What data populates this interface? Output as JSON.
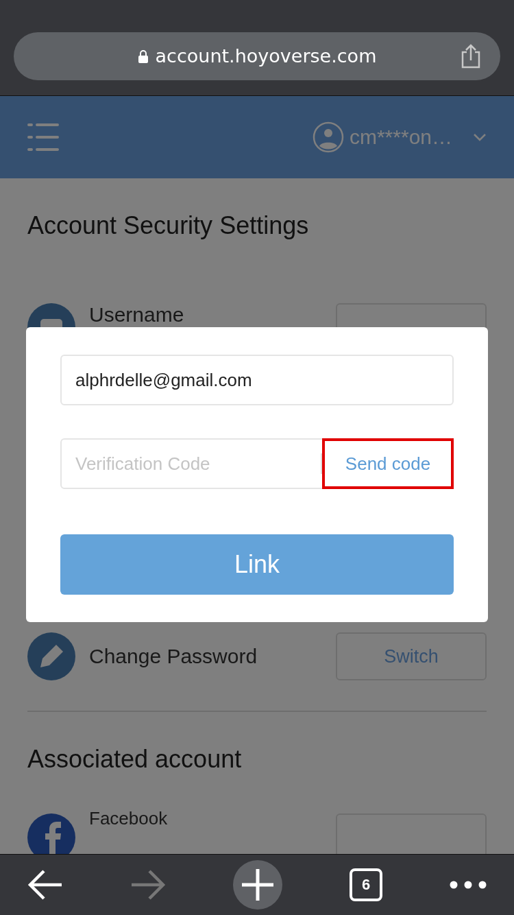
{
  "browser": {
    "url": "account.hoyoverse.com"
  },
  "header": {
    "user": "cm****on…"
  },
  "page": {
    "title": "Account Security Settings",
    "rows": [
      {
        "kind": "user",
        "label": "Username"
      },
      {
        "kind": "pencil",
        "label": "Change Password",
        "button": "Switch"
      }
    ],
    "section": "Associated account",
    "associated": [
      {
        "kind": "facebook",
        "label": "Facebook"
      }
    ]
  },
  "dialog": {
    "email": {
      "value": "alphrdelle@gmail.com"
    },
    "code": {
      "placeholder": "Verification Code"
    },
    "send_code": {
      "label": "Send code",
      "highlighted": true
    },
    "submit": "Link"
  },
  "toolbar": {
    "back_disabled": false,
    "forward_disabled": true,
    "tabs": "6"
  }
}
